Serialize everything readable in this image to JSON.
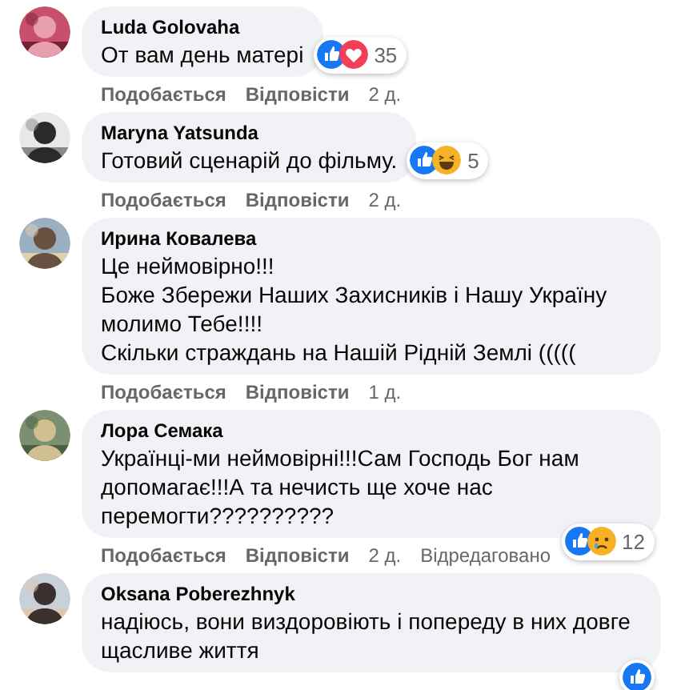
{
  "comments": [
    {
      "author": "Luda Golovaha",
      "paragraphs": [
        "От вам день матері"
      ],
      "reactions": [
        {
          "kind": "like"
        },
        {
          "kind": "love"
        }
      ],
      "reaction_count": "35",
      "actions": [
        "Подобається",
        "Відповісти"
      ],
      "time": "2 д."
    },
    {
      "author": "Maryna Yatsunda",
      "paragraphs": [
        "Готовий сценарій до фільму."
      ],
      "reactions": [
        {
          "kind": "like"
        },
        {
          "kind": "haha"
        }
      ],
      "reaction_count": "5",
      "actions": [
        "Подобається",
        "Відповісти"
      ],
      "time": "2 д."
    },
    {
      "author": "Ирина Ковалева",
      "paragraphs": [
        "Це неймовірно!!!",
        "Боже Збережи Наших Захисників і Нашу Україну молимо Тебе!!!!",
        "Скільки страждань на Нашій Рідній Землі ((((("
      ],
      "actions": [
        "Подобається",
        "Відповісти"
      ],
      "time": "1 д."
    },
    {
      "author": "Лора Семака",
      "paragraphs": [
        "Українці-ми неймовірні!!!Сам Господь Бог нам допомагає!!!А та нечисть ще хоче нас перемогти??????????"
      ],
      "reactions": [
        {
          "kind": "like"
        },
        {
          "kind": "sad"
        }
      ],
      "reaction_count": "12",
      "actions": [
        "Подобається",
        "Відповісти"
      ],
      "time": "2 д.",
      "edited_label": "Відредаговано"
    },
    {
      "author": "Oksana Poberezhnyk",
      "paragraphs": [
        "надіюсь, вони виздоровіють і попереду в них довге щасливе життя"
      ],
      "reactions": [
        {
          "kind": "like"
        }
      ]
    }
  ]
}
